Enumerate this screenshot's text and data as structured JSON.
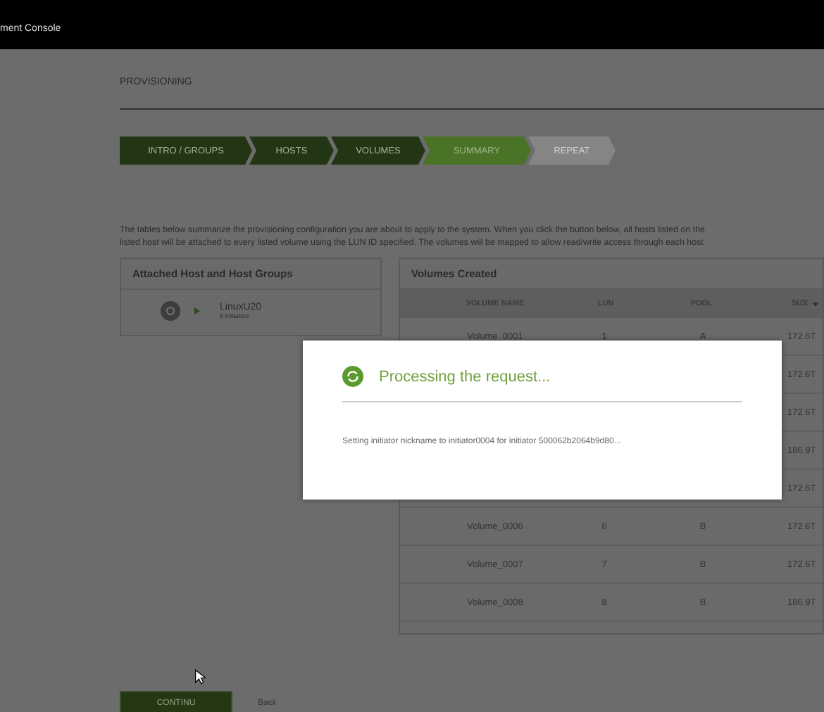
{
  "header": {
    "title": "ment Console"
  },
  "page_title": "PROVISIONING",
  "steps": [
    {
      "label": "INTRO / GROUPS",
      "kind": "done"
    },
    {
      "label": "HOSTS",
      "kind": "done"
    },
    {
      "label": "VOLUMES",
      "kind": "done"
    },
    {
      "label": "SUMMARY",
      "kind": "current"
    },
    {
      "label": "REPEAT",
      "kind": "pending"
    }
  ],
  "description_lines": [
    "The tables below summarize the provisioning configuration you are about to apply to the system. When you click the button below, all hosts listed on the",
    "listed host will be attached to every listed volume using the LUN ID specified. The volumes will be mapped to allow read/write access through each host"
  ],
  "hosts_panel": {
    "title": "Attached Host and Host Groups",
    "hosts": [
      {
        "name": "LinuxU20",
        "detail": "8 Initiators"
      }
    ]
  },
  "volumes_panel": {
    "title": "Volumes Created",
    "columns": [
      "VOLUME NAME",
      "LUN",
      "POOL",
      "SIZE"
    ],
    "rows": [
      {
        "volume_name": "Volume_0001",
        "lun": "1",
        "pool": "A",
        "size": "172.6T"
      },
      {
        "size": "172.6T"
      },
      {
        "size": "172.6T"
      },
      {
        "size": "186.9T"
      },
      {
        "size": "172.6T"
      },
      {
        "volume_name": "Volume_0006",
        "lun": "6",
        "pool": "B",
        "size": "172.6T"
      },
      {
        "volume_name": "Volume_0007",
        "lun": "7",
        "pool": "B",
        "size": "172.6T"
      },
      {
        "volume_name": "Volume_0008",
        "lun": "8",
        "pool": "B",
        "size": "186.9T"
      }
    ]
  },
  "dialog": {
    "title": "Processing the request...",
    "message": "Setting initiator nickname to initiator0004 for initiator 500062b2064b9d80..."
  },
  "buttons": {
    "continue": "CONTINU",
    "back": "Back"
  }
}
